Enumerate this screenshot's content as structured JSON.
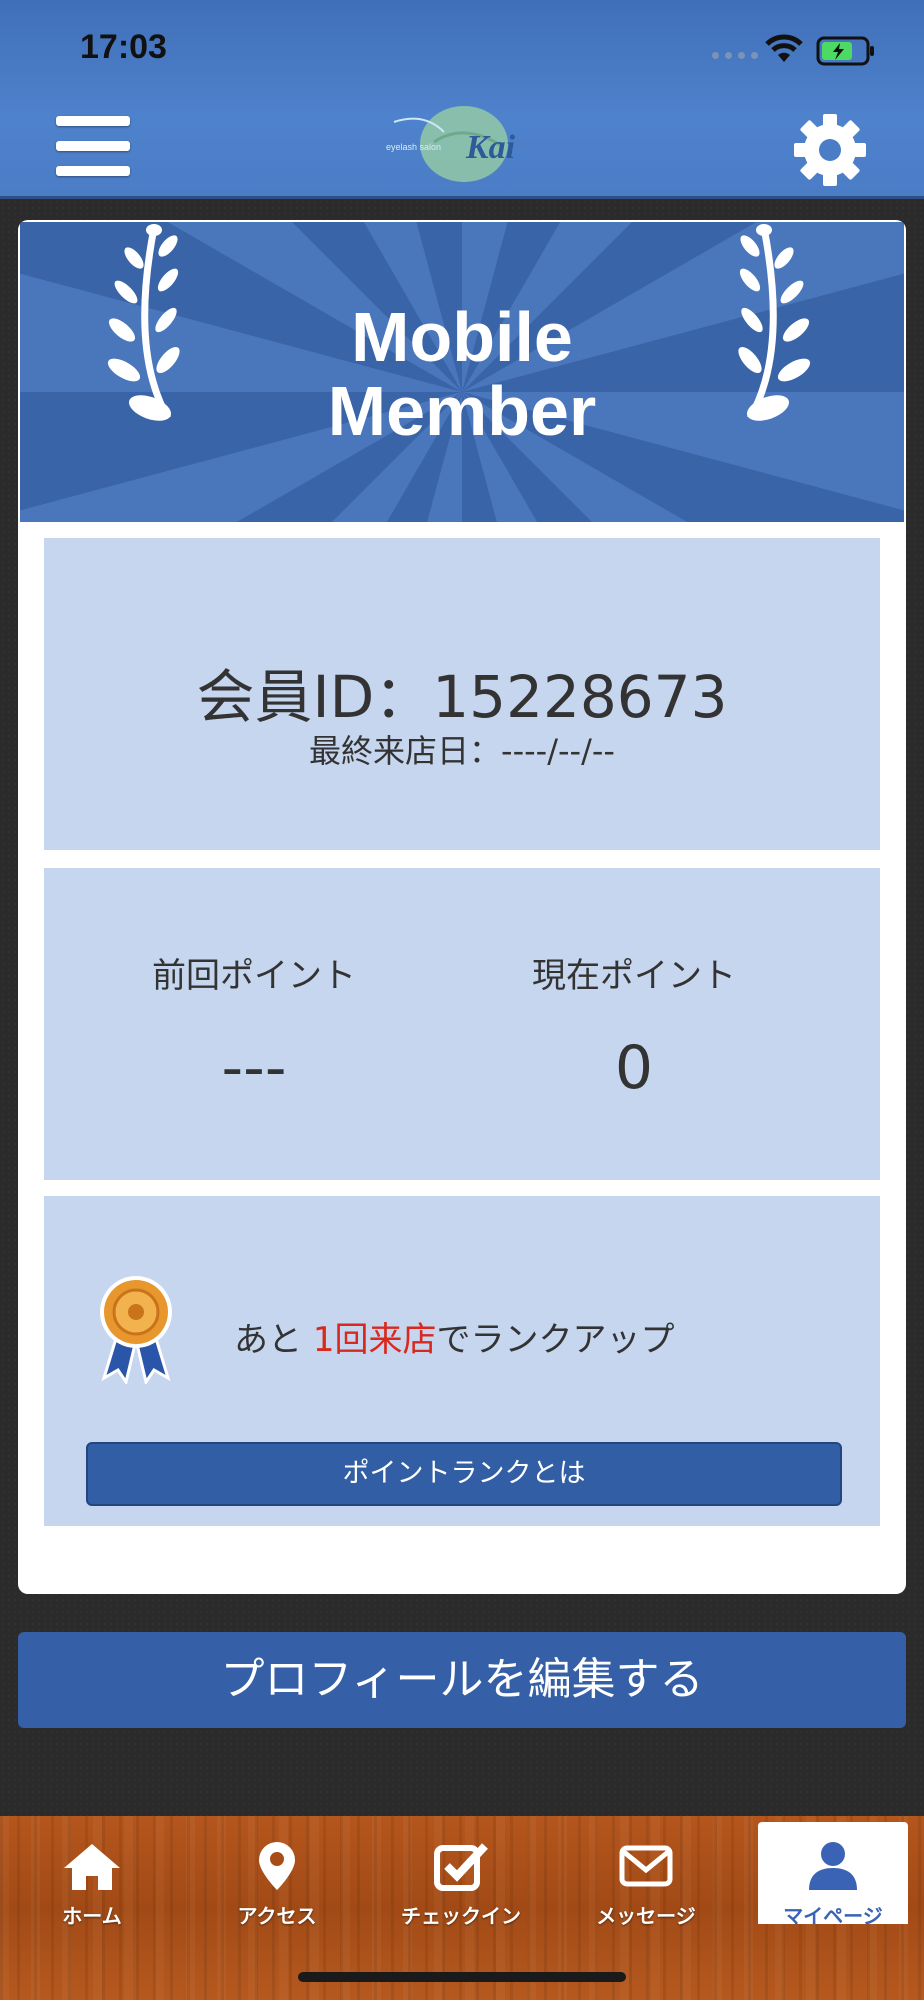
{
  "status": {
    "time": "17:03"
  },
  "header": {
    "logo_alt": "eyelash salon Kai"
  },
  "banner": {
    "title": "Mobile\nMember"
  },
  "member": {
    "id_text": "会員ID：15228673",
    "last_visit": "最終来店日：----/--/--"
  },
  "points": {
    "previous_label": "前回ポイント",
    "previous_value": "---",
    "current_label": "現在ポイント",
    "current_value": "0"
  },
  "rank": {
    "text_before": "あと ",
    "highlight": "1回来店",
    "text_after": "でランクアップ",
    "button_label": "ポイントランクとは"
  },
  "edit_profile_label": "プロフィールを編集する",
  "tabs": [
    {
      "label": "ホーム",
      "icon": "home-icon"
    },
    {
      "label": "アクセス",
      "icon": "map-pin-icon"
    },
    {
      "label": "チェックイン",
      "icon": "checkin-icon"
    },
    {
      "label": "メッセージ",
      "icon": "envelope-icon"
    },
    {
      "label": "マイページ",
      "icon": "user-icon"
    }
  ],
  "colors": {
    "header": "#4b7dc7",
    "primary_button": "#3560a8",
    "panel": "#c7d6ef",
    "highlight": "#d9281e",
    "active_tab": "#3a63b5"
  }
}
